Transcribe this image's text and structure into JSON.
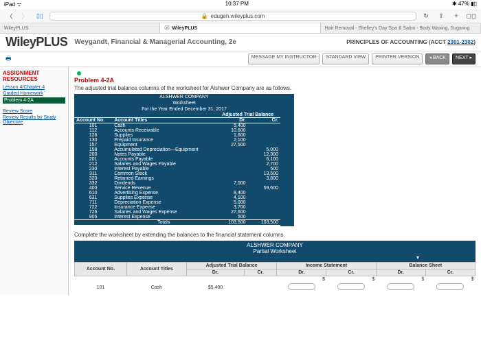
{
  "status": {
    "device": "iPad",
    "wifi": "ᯤ",
    "time": "10:37 PM",
    "bt": "✱",
    "batt": "47%",
    "batt_icon": "▮▯"
  },
  "nav": {
    "url": "edugen.wileyplus.com",
    "lock": "🔒",
    "reload": "↻",
    "share": "⇪",
    "add": "+",
    "tabs": "◻◻"
  },
  "tabs": {
    "t1": "WileyPLUS",
    "t2": "WileyPLUS",
    "t3": "Hair Removal - Shelley's Day Spa & Salon - Body Waxing, Sugaring"
  },
  "brand": "WileyPLUS",
  "subtitle": "Weygandt, Financial & Managerial Accounting, 2e",
  "course": {
    "pre": "PRINCIPLES OF ACCOUNTING (ACCT ",
    "link": "2301-2302",
    "post": ")"
  },
  "toolbar": {
    "msg": "MESSAGE MY INSTRUCTOR",
    "std": "STANDARD VIEW",
    "prn": "PRINTER VERSION",
    "back": "◂ BACK",
    "next": "NEXT ▸"
  },
  "side": {
    "h": "ASSIGNMENT RESOURCES",
    "l1": "Lesson 4/Chapter 4",
    "l2": "Graded Homework",
    "sel": "Problem 4-2A",
    "r1": "Review Score",
    "r2": "Review Results by Study Objective"
  },
  "problem": {
    "title": "Problem 4-2A",
    "desc": "The adjusted trial balance columns of the worksheet for Alshwer Company are as follows.",
    "company": "ALSHWER COMPANY",
    "ws": "Worksheet",
    "period": "For the Year Ended December 31, 2017",
    "atb": "Adjusted Trial Balance",
    "hAccNo": "Account No.",
    "hTitles": "Account Titles",
    "hDr": "Dr.",
    "hCr": "Cr.",
    "rows": [
      {
        "no": "101",
        "t": "Cash",
        "dr": "5,400",
        "cr": ""
      },
      {
        "no": "112",
        "t": "Accounts Receivable",
        "dr": "10,600",
        "cr": ""
      },
      {
        "no": "126",
        "t": "Supplies",
        "dr": "1,600",
        "cr": ""
      },
      {
        "no": "130",
        "t": "Prepaid Insurance",
        "dr": "2,100",
        "cr": ""
      },
      {
        "no": "157",
        "t": "Equipment",
        "dr": "27,500",
        "cr": ""
      },
      {
        "no": "158",
        "t": "Accumulated Depreciation—Equipment",
        "dr": "",
        "cr": "5,000"
      },
      {
        "no": "200",
        "t": "Notes Payable",
        "dr": "",
        "cr": "12,300"
      },
      {
        "no": "201",
        "t": "Accounts Payable",
        "dr": "",
        "cr": "6,100"
      },
      {
        "no": "212",
        "t": "Salaries and Wages Payable",
        "dr": "",
        "cr": "2,700"
      },
      {
        "no": "230",
        "t": "Interest Payable",
        "dr": "",
        "cr": "500"
      },
      {
        "no": "311",
        "t": "Common Stock",
        "dr": "",
        "cr": "13,500"
      },
      {
        "no": "320",
        "t": "Retained Earnings",
        "dr": "",
        "cr": "3,800"
      },
      {
        "no": "332",
        "t": "Dividends",
        "dr": "7,000",
        "cr": ""
      },
      {
        "no": "400",
        "t": "Service Revenue",
        "dr": "",
        "cr": "59,600"
      },
      {
        "no": "610",
        "t": "Advertising Expense",
        "dr": "8,400",
        "cr": ""
      },
      {
        "no": "631",
        "t": "Supplies Expense",
        "dr": "4,100",
        "cr": ""
      },
      {
        "no": "711",
        "t": "Depreciation Expense",
        "dr": "5,000",
        "cr": ""
      },
      {
        "no": "722",
        "t": "Insurance Expense",
        "dr": "3,700",
        "cr": ""
      },
      {
        "no": "726",
        "t": "Salaries and Wages Expense",
        "dr": "27,600",
        "cr": ""
      },
      {
        "no": "905",
        "t": "Interest Expense",
        "dr": "500",
        "cr": ""
      }
    ],
    "totLabel": "Totals",
    "totDr": "103,500",
    "totCr": "103,500"
  },
  "instr": "Complete the worksheet by extending the balances to the financial statement columns.",
  "partial": {
    "company": "ALSHWER COMPANY",
    "title": "Partial Worksheet",
    "cAtb": "Adjusted Trial Balance",
    "cIs": "Income Statement",
    "cBs": "Balance Sheet",
    "hAccNo": "Account No.",
    "hTitles": "Account Titles",
    "hDr": "Dr.",
    "hCr": "Cr.",
    "r1no": "101",
    "r1t": "Cash",
    "r1dr": "$5,400",
    "dollar": "$"
  }
}
